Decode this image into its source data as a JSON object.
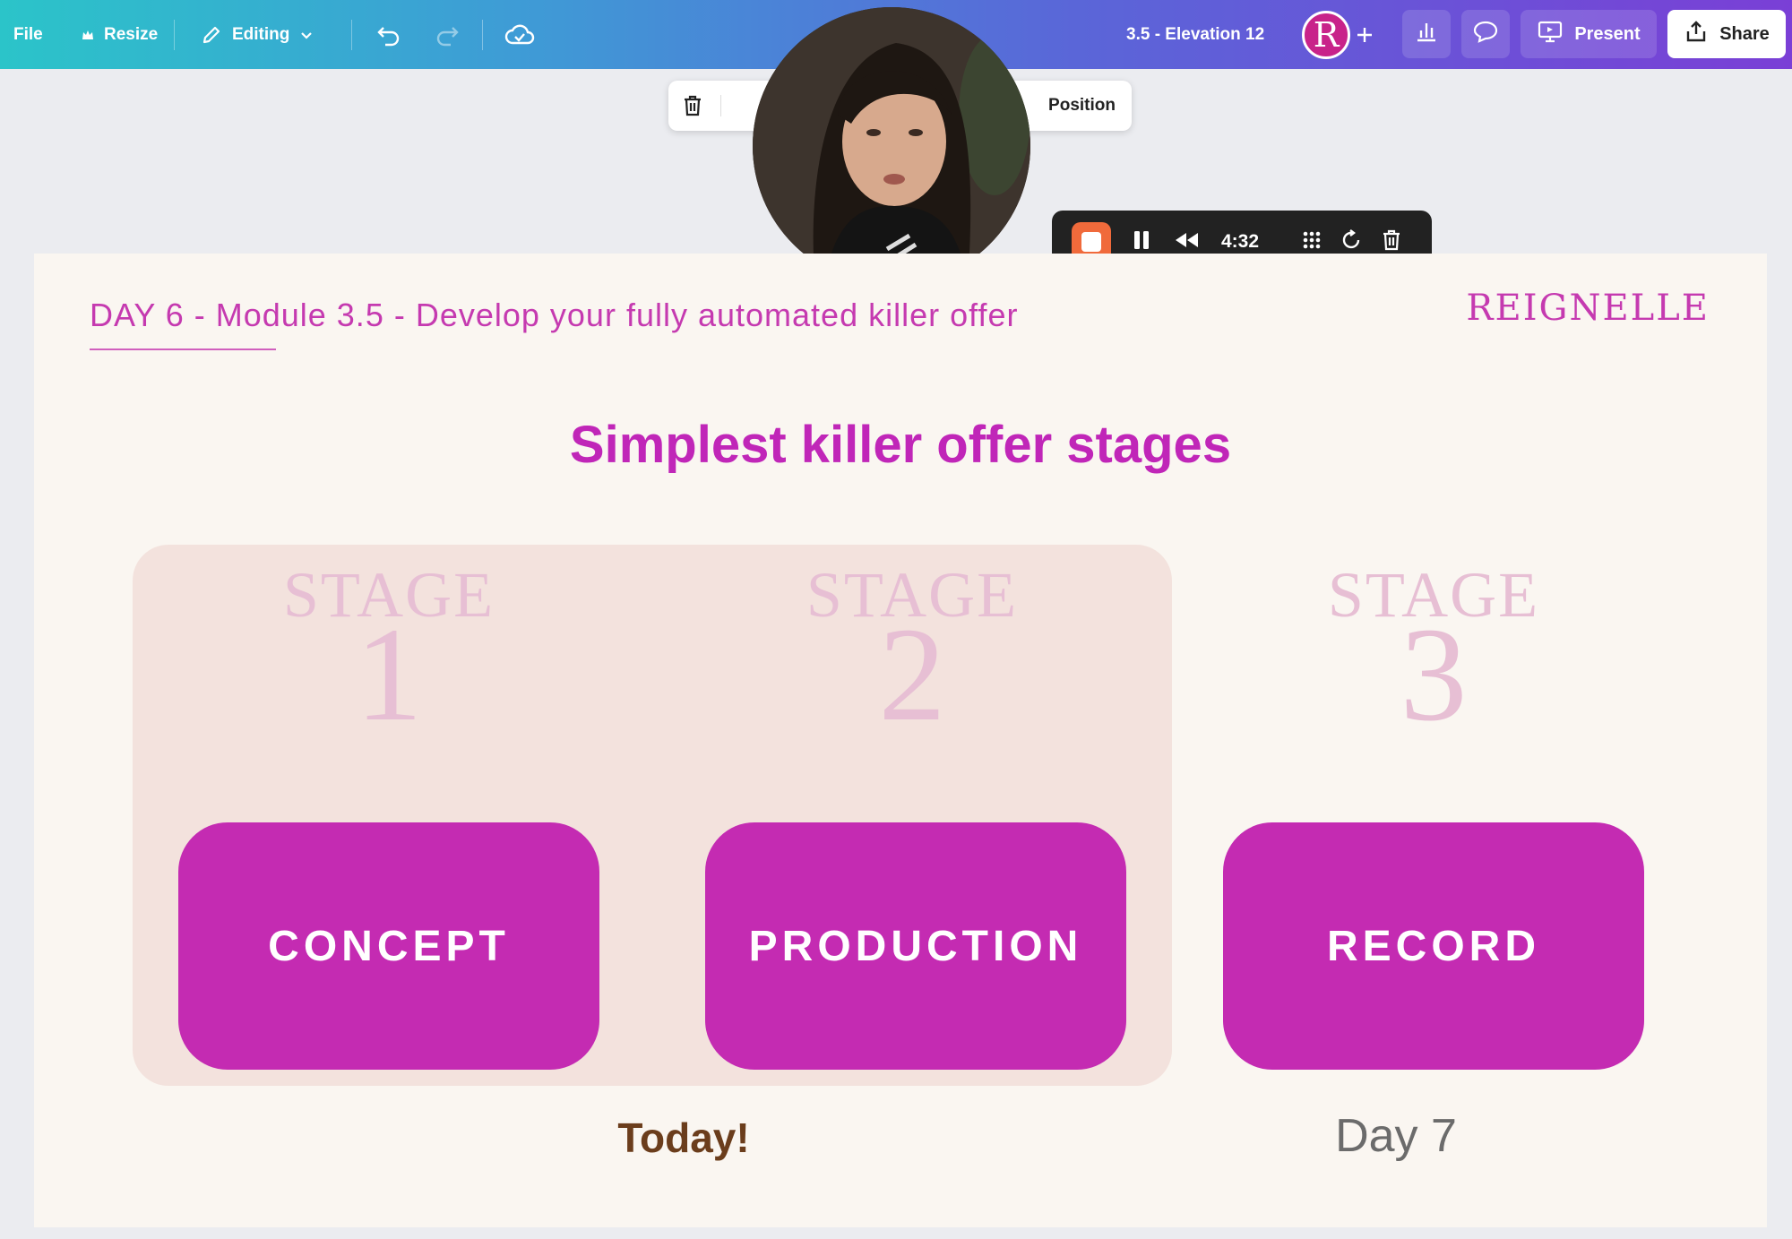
{
  "topbar": {
    "file": "File",
    "resize": "Resize",
    "editing": "Editing",
    "doc_title": "3.5 - Elevation 12",
    "avatar_letter": "R",
    "present": "Present",
    "share": "Share"
  },
  "element_toolbar": {
    "position": "Position"
  },
  "recorder": {
    "time": "4:32"
  },
  "slide": {
    "header": "DAY 6 - Module 3.5 - Develop your fully automated killer offer",
    "logo": "REIGNELLE",
    "title": "Simplest killer offer stages",
    "stages": [
      {
        "word": "STAGE",
        "number": "1",
        "label": "CONCEPT"
      },
      {
        "word": "STAGE",
        "number": "2",
        "label": "PRODUCTION"
      },
      {
        "word": "STAGE",
        "number": "3",
        "label": "RECORD"
      }
    ],
    "today": "Today!",
    "day7": "Day 7"
  },
  "colors": {
    "accent": "#c42bb2",
    "highlight": "#f3e2dd",
    "record": "#f06a3b"
  }
}
